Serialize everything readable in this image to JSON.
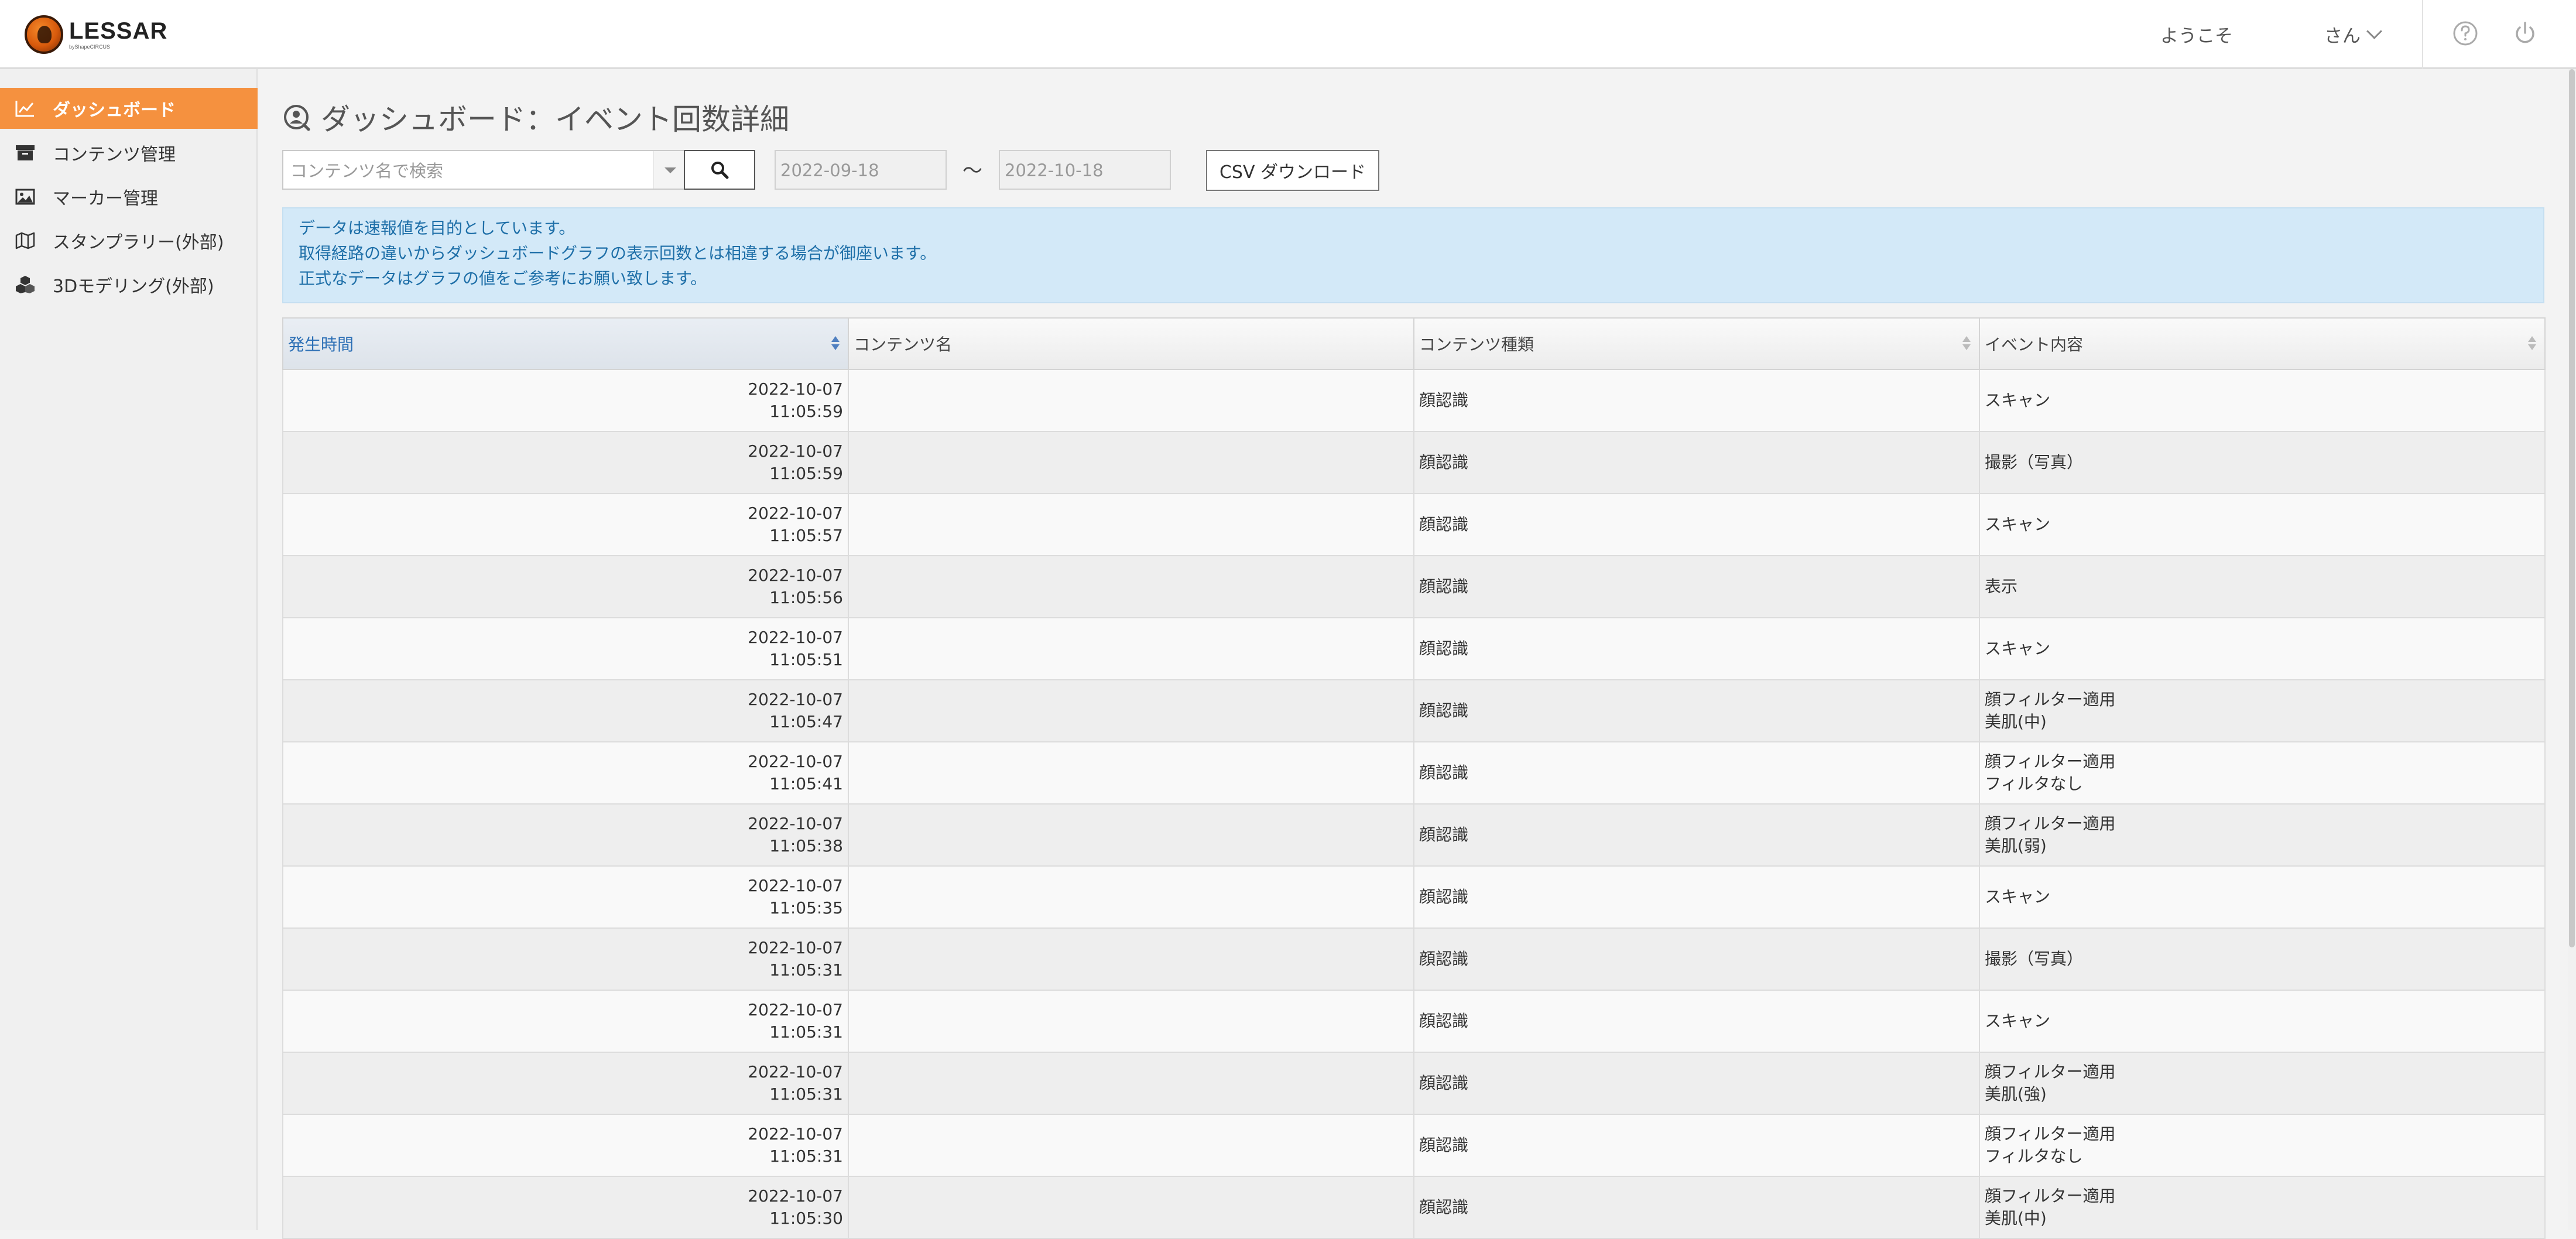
{
  "header": {
    "logo_name": "LESSAR",
    "logo_sub": "byShapeCIRCUS",
    "welcome": "ようこそ",
    "user_label": "さん"
  },
  "sidebar": {
    "items": [
      {
        "label": "ダッシュボード",
        "icon": "chart-line-icon",
        "active": true
      },
      {
        "label": "コンテンツ管理",
        "icon": "archive-box-icon",
        "active": false
      },
      {
        "label": "マーカー管理",
        "icon": "image-icon",
        "active": false
      },
      {
        "label": "スタンプラリー(外部)",
        "icon": "map-icon",
        "active": false
      },
      {
        "label": "3Dモデリング(外部)",
        "icon": "cubes-icon",
        "active": false
      }
    ]
  },
  "main": {
    "title": "ダッシュボード：イベント回数詳細",
    "search": {
      "placeholder": "コンテンツ名で検索",
      "value": ""
    },
    "date_from": "2022-09-18",
    "date_separator": "～",
    "date_to": "2022-10-18",
    "csv_button": "CSV ダウンロード",
    "notice": [
      "データは速報値を目的としています。",
      "取得経路の違いからダッシュボードグラフの表示回数とは相違する場合が御座います。",
      "正式なデータはグラフの値をご参考にお願い致します。"
    ]
  },
  "colors": {
    "accent": "#f5913f",
    "notice_bg": "#d3e9f8",
    "notice_text": "#1e6fa8",
    "sorted_header": "#2c6fb5"
  },
  "table": {
    "columns": [
      "発生時間",
      "コンテンツ名",
      "コンテンツ種類",
      "イベント内容"
    ],
    "sorted_column": "発生時間",
    "rows": [
      {
        "date": "2022-10-07",
        "time": "11:05:59",
        "name": "",
        "type": "顔認識",
        "event": [
          "スキャン"
        ]
      },
      {
        "date": "2022-10-07",
        "time": "11:05:59",
        "name": "",
        "type": "顔認識",
        "event": [
          "撮影（写真）"
        ]
      },
      {
        "date": "2022-10-07",
        "time": "11:05:57",
        "name": "",
        "type": "顔認識",
        "event": [
          "スキャン"
        ]
      },
      {
        "date": "2022-10-07",
        "time": "11:05:56",
        "name": "",
        "type": "顔認識",
        "event": [
          "表示"
        ]
      },
      {
        "date": "2022-10-07",
        "time": "11:05:51",
        "name": "",
        "type": "顔認識",
        "event": [
          "スキャン"
        ]
      },
      {
        "date": "2022-10-07",
        "time": "11:05:47",
        "name": "",
        "type": "顔認識",
        "event": [
          "顔フィルター適用",
          "美肌(中)"
        ]
      },
      {
        "date": "2022-10-07",
        "time": "11:05:41",
        "name": "",
        "type": "顔認識",
        "event": [
          "顔フィルター適用",
          "フィルタなし"
        ]
      },
      {
        "date": "2022-10-07",
        "time": "11:05:38",
        "name": "",
        "type": "顔認識",
        "event": [
          "顔フィルター適用",
          "美肌(弱)"
        ]
      },
      {
        "date": "2022-10-07",
        "time": "11:05:35",
        "name": "",
        "type": "顔認識",
        "event": [
          "スキャン"
        ]
      },
      {
        "date": "2022-10-07",
        "time": "11:05:31",
        "name": "",
        "type": "顔認識",
        "event": [
          "撮影（写真）"
        ]
      },
      {
        "date": "2022-10-07",
        "time": "11:05:31",
        "name": "",
        "type": "顔認識",
        "event": [
          "スキャン"
        ]
      },
      {
        "date": "2022-10-07",
        "time": "11:05:31",
        "name": "",
        "type": "顔認識",
        "event": [
          "顔フィルター適用",
          "美肌(強)"
        ]
      },
      {
        "date": "2022-10-07",
        "time": "11:05:31",
        "name": "",
        "type": "顔認識",
        "event": [
          "顔フィルター適用",
          "フィルタなし"
        ]
      },
      {
        "date": "2022-10-07",
        "time": "11:05:30",
        "name": "",
        "type": "顔認識",
        "event": [
          "顔フィルター適用",
          "美肌(中)"
        ]
      }
    ]
  }
}
